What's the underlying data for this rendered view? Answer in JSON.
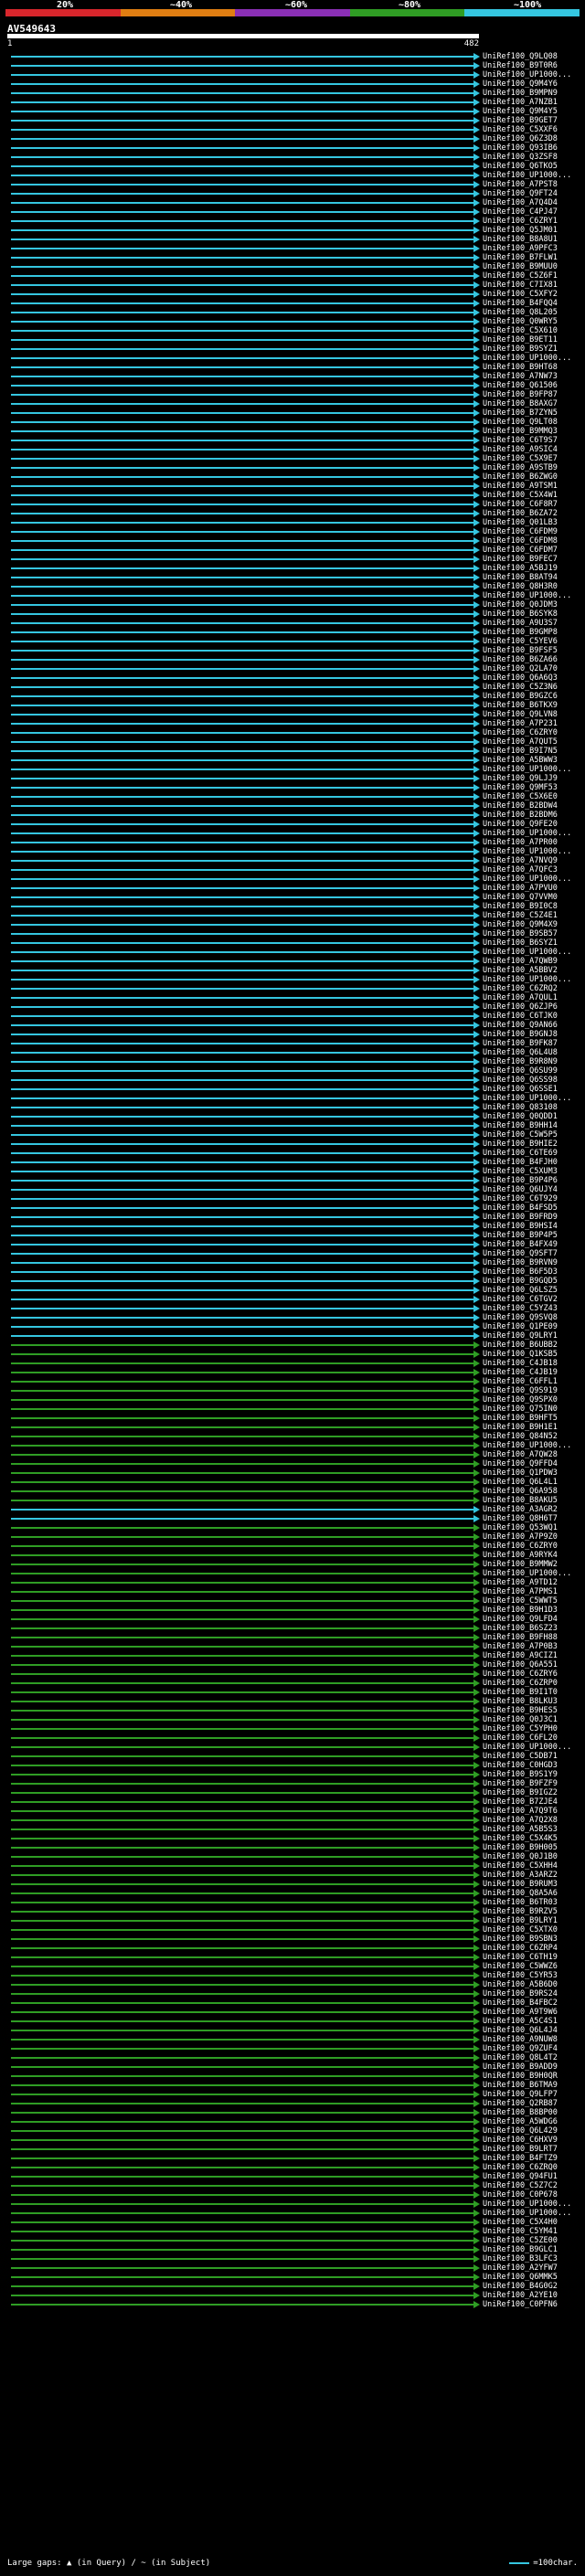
{
  "legend": {
    "labels": [
      "20%",
      "~40%",
      "~60%",
      "~80%",
      "~100%"
    ],
    "colors": [
      "#d8262c",
      "#e07e12",
      "#8a2fb5",
      "#2f9d24",
      "#35c6e0"
    ]
  },
  "title": "AV549643",
  "scale": {
    "start": "1",
    "end": "482"
  },
  "footer": {
    "gaps": "Large gaps: ▲ (in Query) / ~ (in Subject)",
    "key": "=100char."
  },
  "hits": [
    {
      "id": "UniRef100_Q9LQ08",
      "class": "cyan"
    },
    {
      "id": "UniRef100_B9T0R6",
      "class": "cyan"
    },
    {
      "id": "UniRef100_UP1000...",
      "class": "cyan"
    },
    {
      "id": "UniRef100_Q9M4Y6",
      "class": "cyan"
    },
    {
      "id": "UniRef100_B9MPN9",
      "class": "cyan"
    },
    {
      "id": "UniRef100_A7NZB1",
      "class": "cyan"
    },
    {
      "id": "UniRef100_Q9M4Y5",
      "class": "cyan"
    },
    {
      "id": "UniRef100_B9GET7",
      "class": "cyan"
    },
    {
      "id": "UniRef100_C5XXF6",
      "class": "cyan"
    },
    {
      "id": "UniRef100_Q6Z3D8",
      "class": "cyan"
    },
    {
      "id": "UniRef100_Q93IB6",
      "class": "cyan"
    },
    {
      "id": "UniRef100_Q3ZSF8",
      "class": "cyan"
    },
    {
      "id": "UniRef100_Q6TKO5",
      "class": "cyan"
    },
    {
      "id": "UniRef100_UP1000...",
      "class": "cyan"
    },
    {
      "id": "UniRef100_A7PST8",
      "class": "cyan"
    },
    {
      "id": "UniRef100_Q9FT24",
      "class": "cyan"
    },
    {
      "id": "UniRef100_A7Q4D4",
      "class": "cyan"
    },
    {
      "id": "UniRef100_C4PJ47",
      "class": "cyan"
    },
    {
      "id": "UniRef100_C6ZRY1",
      "class": "cyan"
    },
    {
      "id": "UniRef100_Q5JM01",
      "class": "cyan"
    },
    {
      "id": "UniRef100_B8A8U1",
      "class": "cyan"
    },
    {
      "id": "UniRef100_A9PFC3",
      "class": "cyan"
    },
    {
      "id": "UniRef100_B7FLW1",
      "class": "cyan"
    },
    {
      "id": "UniRef100_B9MUU0",
      "class": "cyan"
    },
    {
      "id": "UniRef100_C5Z6F1",
      "class": "cyan"
    },
    {
      "id": "UniRef100_C7IX81",
      "class": "cyan"
    },
    {
      "id": "UniRef100_C5XFY2",
      "class": "cyan"
    },
    {
      "id": "UniRef100_B4FQQ4",
      "class": "cyan"
    },
    {
      "id": "UniRef100_Q8L205",
      "class": "cyan"
    },
    {
      "id": "UniRef100_Q0WRY5",
      "class": "cyan"
    },
    {
      "id": "UniRef100_C5X610",
      "class": "cyan"
    },
    {
      "id": "UniRef100_B9ET11",
      "class": "cyan"
    },
    {
      "id": "UniRef100_B9SYZ1",
      "class": "cyan"
    },
    {
      "id": "UniRef100_UP1000...",
      "class": "cyan"
    },
    {
      "id": "UniRef100_B9HT68",
      "class": "cyan"
    },
    {
      "id": "UniRef100_A7NW73",
      "class": "cyan"
    },
    {
      "id": "UniRef100_Q61506",
      "class": "cyan"
    },
    {
      "id": "UniRef100_B9FP87",
      "class": "cyan"
    },
    {
      "id": "UniRef100_B8AXG7",
      "class": "cyan"
    },
    {
      "id": "UniRef100_B7ZYN5",
      "class": "cyan"
    },
    {
      "id": "UniRef100_Q9LT08",
      "class": "cyan"
    },
    {
      "id": "UniRef100_B9MMQ3",
      "class": "cyan"
    },
    {
      "id": "UniRef100_C6T9S7",
      "class": "cyan"
    },
    {
      "id": "UniRef100_A9SIC4",
      "class": "cyan"
    },
    {
      "id": "UniRef100_C5X9E7",
      "class": "cyan"
    },
    {
      "id": "UniRef100_A9STB9",
      "class": "cyan"
    },
    {
      "id": "UniRef100_B6ZWG0",
      "class": "cyan"
    },
    {
      "id": "UniRef100_A9TSM1",
      "class": "cyan"
    },
    {
      "id": "UniRef100_C5X4W1",
      "class": "cyan"
    },
    {
      "id": "UniRef100_C6F8R7",
      "class": "cyan"
    },
    {
      "id": "UniRef100_B6ZA72",
      "class": "cyan"
    },
    {
      "id": "UniRef100_Q01LB3",
      "class": "cyan"
    },
    {
      "id": "UniRef100_C6FDM9",
      "class": "cyan"
    },
    {
      "id": "UniRef100_C6FDM8",
      "class": "cyan"
    },
    {
      "id": "UniRef100_C6FDM7",
      "class": "cyan"
    },
    {
      "id": "UniRef100_B9FEC7",
      "class": "cyan"
    },
    {
      "id": "UniRef100_A5BJ19",
      "class": "cyan"
    },
    {
      "id": "UniRef100_B8AT94",
      "class": "cyan"
    },
    {
      "id": "UniRef100_Q8H3R0",
      "class": "cyan"
    },
    {
      "id": "UniRef100_UP1000...",
      "class": "cyan"
    },
    {
      "id": "UniRef100_Q0JDM3",
      "class": "cyan"
    },
    {
      "id": "UniRef100_B6SYK8",
      "class": "cyan"
    },
    {
      "id": "UniRef100_A9U3S7",
      "class": "cyan"
    },
    {
      "id": "UniRef100_B9GMP8",
      "class": "cyan"
    },
    {
      "id": "UniRef100_C5YEV6",
      "class": "cyan"
    },
    {
      "id": "UniRef100_B9FSF5",
      "class": "cyan"
    },
    {
      "id": "UniRef100_B6ZA66",
      "class": "cyan"
    },
    {
      "id": "UniRef100_Q2LA70",
      "class": "cyan"
    },
    {
      "id": "UniRef100_Q6A6Q3",
      "class": "cyan"
    },
    {
      "id": "UniRef100_C5Z3N6",
      "class": "cyan"
    },
    {
      "id": "UniRef100_B9GZC6",
      "class": "cyan"
    },
    {
      "id": "UniRef100_B6TKX9",
      "class": "cyan"
    },
    {
      "id": "UniRef100_Q9LVN8",
      "class": "cyan"
    },
    {
      "id": "UniRef100_A7P231",
      "class": "cyan"
    },
    {
      "id": "UniRef100_C6ZRY0",
      "class": "cyan"
    },
    {
      "id": "UniRef100_A7QUT5",
      "class": "cyan"
    },
    {
      "id": "UniRef100_B9I7N5",
      "class": "cyan"
    },
    {
      "id": "UniRef100_A5BWW3",
      "class": "cyan"
    },
    {
      "id": "UniRef100_UP1000...",
      "class": "cyan"
    },
    {
      "id": "UniRef100_Q9LJJ9",
      "class": "cyan"
    },
    {
      "id": "UniRef100_Q9MF53",
      "class": "cyan"
    },
    {
      "id": "UniRef100_C5X6E0",
      "class": "cyan"
    },
    {
      "id": "UniRef100_B2BDW4",
      "class": "cyan"
    },
    {
      "id": "UniRef100_B2BDM6",
      "class": "cyan"
    },
    {
      "id": "UniRef100_Q9FE20",
      "class": "cyan"
    },
    {
      "id": "UniRef100_UP1000...",
      "class": "cyan"
    },
    {
      "id": "UniRef100_A7PR00",
      "class": "cyan"
    },
    {
      "id": "UniRef100_UP1000...",
      "class": "cyan"
    },
    {
      "id": "UniRef100_A7NVQ9",
      "class": "cyan"
    },
    {
      "id": "UniRef100_A7QFC3",
      "class": "cyan"
    },
    {
      "id": "UniRef100_UP1000...",
      "class": "cyan"
    },
    {
      "id": "UniRef100_A7PVU0",
      "class": "cyan"
    },
    {
      "id": "UniRef100_Q7VVM0",
      "class": "cyan"
    },
    {
      "id": "UniRef100_B9I0C8",
      "class": "cyan"
    },
    {
      "id": "UniRef100_C5Z4E1",
      "class": "cyan"
    },
    {
      "id": "UniRef100_Q9M4X9",
      "class": "cyan"
    },
    {
      "id": "UniRef100_B9SB57",
      "class": "cyan"
    },
    {
      "id": "UniRef100_B6SYZ1",
      "class": "cyan"
    },
    {
      "id": "UniRef100_UP1000...",
      "class": "cyan"
    },
    {
      "id": "UniRef100_A7QWB9",
      "class": "cyan"
    },
    {
      "id": "UniRef100_A5BBV2",
      "class": "cyan"
    },
    {
      "id": "UniRef100_UP1000...",
      "class": "cyan"
    },
    {
      "id": "UniRef100_C6ZRQ2",
      "class": "cyan"
    },
    {
      "id": "UniRef100_A7QUL1",
      "class": "cyan"
    },
    {
      "id": "UniRef100_Q6ZJP6",
      "class": "cyan"
    },
    {
      "id": "UniRef100_C6TJK0",
      "class": "cyan"
    },
    {
      "id": "UniRef100_Q9AN66",
      "class": "cyan"
    },
    {
      "id": "UniRef100_B9GNJ8",
      "class": "cyan"
    },
    {
      "id": "UniRef100_B9FK87",
      "class": "cyan"
    },
    {
      "id": "UniRef100_Q6L4U8",
      "class": "cyan"
    },
    {
      "id": "UniRef100_B9R8N9",
      "class": "cyan"
    },
    {
      "id": "UniRef100_Q6SU99",
      "class": "cyan"
    },
    {
      "id": "UniRef100_Q6SS98",
      "class": "cyan"
    },
    {
      "id": "UniRef100_Q6SSE1",
      "class": "cyan"
    },
    {
      "id": "UniRef100_UP1000...",
      "class": "cyan"
    },
    {
      "id": "UniRef100_Q83108",
      "class": "cyan"
    },
    {
      "id": "UniRef100_Q0QDD1",
      "class": "cyan"
    },
    {
      "id": "UniRef100_B9HH14",
      "class": "cyan"
    },
    {
      "id": "UniRef100_C5W5P5",
      "class": "cyan"
    },
    {
      "id": "UniRef100_B9HIE2",
      "class": "cyan"
    },
    {
      "id": "UniRef100_C6TE69",
      "class": "cyan"
    },
    {
      "id": "UniRef100_B4FJH0",
      "class": "cyan"
    },
    {
      "id": "UniRef100_C5XUM3",
      "class": "cyan"
    },
    {
      "id": "UniRef100_B9P4P6",
      "class": "cyan"
    },
    {
      "id": "UniRef100_Q6UJY4",
      "class": "cyan"
    },
    {
      "id": "UniRef100_C6T929",
      "class": "cyan"
    },
    {
      "id": "UniRef100_B4FSD5",
      "class": "cyan"
    },
    {
      "id": "UniRef100_B9FRD9",
      "class": "cyan"
    },
    {
      "id": "UniRef100_B9HSI4",
      "class": "cyan"
    },
    {
      "id": "UniRef100_B9P4P5",
      "class": "cyan"
    },
    {
      "id": "UniRef100_B4FX49",
      "class": "cyan"
    },
    {
      "id": "UniRef100_Q9SFT7",
      "class": "cyan"
    },
    {
      "id": "UniRef100_B9RVN9",
      "class": "cyan"
    },
    {
      "id": "UniRef100_B6F5D3",
      "class": "cyan"
    },
    {
      "id": "UniRef100_B9GQD5",
      "class": "cyan"
    },
    {
      "id": "UniRef100_Q6LSZ5",
      "class": "cyan"
    },
    {
      "id": "UniRef100_C6TGV2",
      "class": "cyan"
    },
    {
      "id": "UniRef100_C5YZ43",
      "class": "cyan"
    },
    {
      "id": "UniRef100_Q9SVQ8",
      "class": "cyan"
    },
    {
      "id": "UniRef100_Q1PE09",
      "class": "cyan"
    },
    {
      "id": "UniRef100_Q9LRY1",
      "class": "cyan"
    },
    {
      "id": "UniRef100_B6UBB2",
      "class": "green"
    },
    {
      "id": "UniRef100_Q1KSB5",
      "class": "green"
    },
    {
      "id": "UniRef100_C4JB18",
      "class": "green"
    },
    {
      "id": "UniRef100_C4JB19",
      "class": "green"
    },
    {
      "id": "UniRef100_C6FFL1",
      "class": "green"
    },
    {
      "id": "UniRef100_Q9S919",
      "class": "green"
    },
    {
      "id": "UniRef100_Q9SPX0",
      "class": "green"
    },
    {
      "id": "UniRef100_Q75IN0",
      "class": "green"
    },
    {
      "id": "UniRef100_B9HFT5",
      "class": "green"
    },
    {
      "id": "UniRef100_B9H1E1",
      "class": "green"
    },
    {
      "id": "UniRef100_Q84N52",
      "class": "green"
    },
    {
      "id": "UniRef100_UP1000...",
      "class": "green"
    },
    {
      "id": "UniRef100_A7QW28",
      "class": "green"
    },
    {
      "id": "UniRef100_Q9FFD4",
      "class": "green"
    },
    {
      "id": "UniRef100_Q1PDW3",
      "class": "green"
    },
    {
      "id": "UniRef100_Q6L4L1",
      "class": "green"
    },
    {
      "id": "UniRef100_Q6A958",
      "class": "green"
    },
    {
      "id": "UniRef100_B8AKU5",
      "class": "green"
    },
    {
      "id": "UniRef100_A3AGR2",
      "class": "cyan"
    },
    {
      "id": "UniRef100_Q8H6T7",
      "class": "cyan"
    },
    {
      "id": "UniRef100_Q53WQ1",
      "class": "green"
    },
    {
      "id": "UniRef100_A7P9Z0",
      "class": "green"
    },
    {
      "id": "UniRef100_C6ZRY0",
      "class": "green"
    },
    {
      "id": "UniRef100_A9RYK4",
      "class": "green"
    },
    {
      "id": "UniRef100_B9MMW2",
      "class": "green"
    },
    {
      "id": "UniRef100_UP1000...",
      "class": "green"
    },
    {
      "id": "UniRef100_A9TD12",
      "class": "green"
    },
    {
      "id": "UniRef100_A7PMS1",
      "class": "green"
    },
    {
      "id": "UniRef100_C5WWT5",
      "class": "green"
    },
    {
      "id": "UniRef100_B9H1D3",
      "class": "green"
    },
    {
      "id": "UniRef100_Q9LFD4",
      "class": "green"
    },
    {
      "id": "UniRef100_B6SZ23",
      "class": "green"
    },
    {
      "id": "UniRef100_B9FH88",
      "class": "green"
    },
    {
      "id": "UniRef100_A7P0B3",
      "class": "green"
    },
    {
      "id": "UniRef100_A9CIZ1",
      "class": "green"
    },
    {
      "id": "UniRef100_Q6A551",
      "class": "green"
    },
    {
      "id": "UniRef100_C6ZRY6",
      "class": "green"
    },
    {
      "id": "UniRef100_C6ZRP0",
      "class": "green"
    },
    {
      "id": "UniRef100_B9I1T0",
      "class": "green"
    },
    {
      "id": "UniRef100_B8LKU3",
      "class": "green"
    },
    {
      "id": "UniRef100_B9HES5",
      "class": "green"
    },
    {
      "id": "UniRef100_Q0J3C1",
      "class": "green"
    },
    {
      "id": "UniRef100_C5YPH0",
      "class": "green"
    },
    {
      "id": "UniRef100_C6FL20",
      "class": "green"
    },
    {
      "id": "UniRef100_UP1000...",
      "class": "green"
    },
    {
      "id": "UniRef100_C5DB71",
      "class": "green"
    },
    {
      "id": "UniRef100_C0HGD3",
      "class": "green"
    },
    {
      "id": "UniRef100_B9S1Y9",
      "class": "green"
    },
    {
      "id": "UniRef100_B9FZF9",
      "class": "green"
    },
    {
      "id": "UniRef100_B9IGZ2",
      "class": "green"
    },
    {
      "id": "UniRef100_B7ZJE4",
      "class": "green"
    },
    {
      "id": "UniRef100_A7Q9T6",
      "class": "green"
    },
    {
      "id": "UniRef100_A7Q2X8",
      "class": "green"
    },
    {
      "id": "UniRef100_A5B5S3",
      "class": "green"
    },
    {
      "id": "UniRef100_C5X4K5",
      "class": "green"
    },
    {
      "id": "UniRef100_B9H005",
      "class": "green"
    },
    {
      "id": "UniRef100_Q0J1B0",
      "class": "green"
    },
    {
      "id": "UniRef100_C5XHH4",
      "class": "green"
    },
    {
      "id": "UniRef100_A3ARZ2",
      "class": "green"
    },
    {
      "id": "UniRef100_B9RUM3",
      "class": "green"
    },
    {
      "id": "UniRef100_Q8A5A6",
      "class": "green"
    },
    {
      "id": "UniRef100_B6TR03",
      "class": "green"
    },
    {
      "id": "UniRef100_B9RZV5",
      "class": "green"
    },
    {
      "id": "UniRef100_B9LRY1",
      "class": "green"
    },
    {
      "id": "UniRef100_C5XTX0",
      "class": "green"
    },
    {
      "id": "UniRef100_B9SBN3",
      "class": "green"
    },
    {
      "id": "UniRef100_C6ZRP4",
      "class": "green"
    },
    {
      "id": "UniRef100_C6TH19",
      "class": "green"
    },
    {
      "id": "UniRef100_C5WWZ6",
      "class": "green"
    },
    {
      "id": "UniRef100_C5YR53",
      "class": "green"
    },
    {
      "id": "UniRef100_A5B6D0",
      "class": "green"
    },
    {
      "id": "UniRef100_B9RS24",
      "class": "green"
    },
    {
      "id": "UniRef100_B4FBC2",
      "class": "green"
    },
    {
      "id": "UniRef100_A9T9W6",
      "class": "green"
    },
    {
      "id": "UniRef100_A5C4S1",
      "class": "green"
    },
    {
      "id": "UniRef100_Q6L4J4",
      "class": "green"
    },
    {
      "id": "UniRef100_A9NUW8",
      "class": "green"
    },
    {
      "id": "UniRef100_Q9ZUF4",
      "class": "green"
    },
    {
      "id": "UniRef100_Q8L4T2",
      "class": "green"
    },
    {
      "id": "UniRef100_B9ADD9",
      "class": "green"
    },
    {
      "id": "UniRef100_B9H0QR",
      "class": "green"
    },
    {
      "id": "UniRef100_B6TMA9",
      "class": "green"
    },
    {
      "id": "UniRef100_Q9LFP7",
      "class": "green"
    },
    {
      "id": "UniRef100_Q2RB87",
      "class": "green"
    },
    {
      "id": "UniRef100_B8BP00",
      "class": "green"
    },
    {
      "id": "UniRef100_A5WDG6",
      "class": "green"
    },
    {
      "id": "UniRef100_Q6L429",
      "class": "green"
    },
    {
      "id": "UniRef100_C6HXV9",
      "class": "green"
    },
    {
      "id": "UniRef100_B9LRT7",
      "class": "green"
    },
    {
      "id": "UniRef100_B4FTZ9",
      "class": "green"
    },
    {
      "id": "UniRef100_C6ZRQ0",
      "class": "green"
    },
    {
      "id": "UniRef100_Q94FU1",
      "class": "green"
    },
    {
      "id": "UniRef100_C5Z7C2",
      "class": "green"
    },
    {
      "id": "UniRef100_C0P678",
      "class": "green"
    },
    {
      "id": "UniRef100_UP1000...",
      "class": "green"
    },
    {
      "id": "UniRef100_UP1000...",
      "class": "green"
    },
    {
      "id": "UniRef100_C5X4H0",
      "class": "green"
    },
    {
      "id": "UniRef100_C5YM41",
      "class": "green"
    },
    {
      "id": "UniRef100_C5ZE00",
      "class": "green"
    },
    {
      "id": "UniRef100_B9GLC1",
      "class": "green"
    },
    {
      "id": "UniRef100_B3LFC3",
      "class": "green"
    },
    {
      "id": "UniRef100_A2YFW7",
      "class": "green"
    },
    {
      "id": "UniRef100_Q6MMK5",
      "class": "green"
    },
    {
      "id": "UniRef100_B4G0G2",
      "class": "green"
    },
    {
      "id": "UniRef100_A2YE10",
      "class": "green"
    },
    {
      "id": "UniRef100_C0PFN6",
      "class": "green"
    }
  ]
}
